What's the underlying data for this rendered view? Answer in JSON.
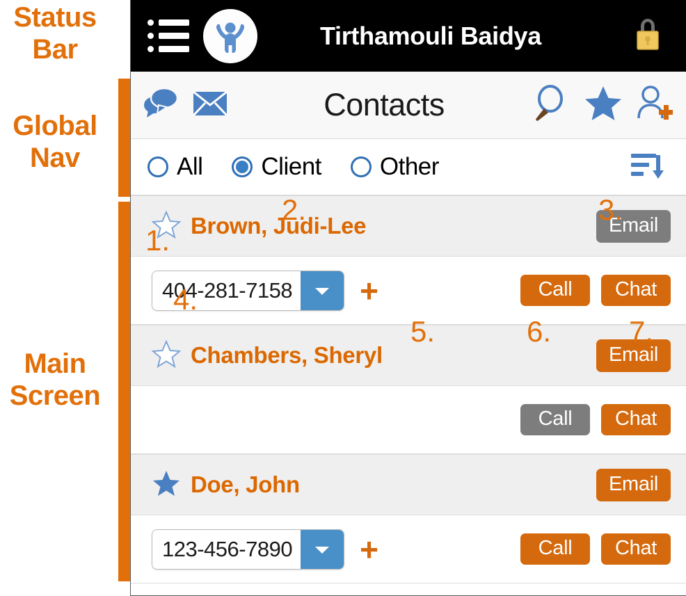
{
  "annotations": {
    "regions": [
      {
        "id": "status-bar",
        "label": "Status\nBar"
      },
      {
        "id": "global-nav",
        "label": "Global\nNav"
      },
      {
        "id": "main-screen",
        "label": "Main\nScreen"
      }
    ],
    "status_label_line1": "Status",
    "status_label_line2": "Bar",
    "global_label_line1": "Global",
    "global_label_line2": "Nav",
    "main_label_line1": "Main",
    "main_label_line2": "Screen",
    "numbers": [
      "1.",
      "2.",
      "3.",
      "4.",
      "5.",
      "6.",
      "7."
    ]
  },
  "status_bar": {
    "menu_icon": "hamburger-list-icon",
    "logo_icon": "app-logo-person-icon",
    "title": "Tirthamouli Baidya",
    "lock_icon": "padlock-icon"
  },
  "global_nav": {
    "chat_icon": "chat-bubbles-icon",
    "mail_icon": "envelope-icon",
    "title": "Contacts",
    "search_icon": "magnifier-icon",
    "favorites_icon": "star-icon",
    "add_contact_icon": "add-user-icon"
  },
  "filter": {
    "options": [
      {
        "label": "All",
        "selected": false
      },
      {
        "label": "Client",
        "selected": true
      },
      {
        "label": "Other",
        "selected": false
      }
    ],
    "sort_icon": "sort-descending-icon"
  },
  "contacts": [
    {
      "name": "Brown, Judi-Lee",
      "favorite": false,
      "star_icon": "star-outline-icon",
      "email_label": "Email",
      "email_state": "disabled",
      "phone_value": "404-281-7158",
      "has_phone": true,
      "add_phone_label": "+",
      "call_label": "Call",
      "call_state": "enabled",
      "chat_label": "Chat",
      "chat_state": "enabled"
    },
    {
      "name": "Chambers, Sheryl",
      "favorite": false,
      "star_icon": "star-outline-icon",
      "email_label": "Email",
      "email_state": "enabled",
      "phone_value": "",
      "has_phone": false,
      "add_phone_label": "",
      "call_label": "Call",
      "call_state": "disabled",
      "chat_label": "Chat",
      "chat_state": "enabled"
    },
    {
      "name": "Doe, John",
      "favorite": true,
      "star_icon": "star-filled-icon",
      "email_label": "Email",
      "email_state": "enabled",
      "phone_value": "123-456-7890",
      "has_phone": true,
      "add_phone_label": "+",
      "call_label": "Call",
      "call_state": "enabled",
      "chat_label": "Chat",
      "chat_state": "enabled"
    }
  ],
  "colors": {
    "accent_orange": "#D4690D",
    "annotation_orange": "#E2700A",
    "contact_name_orange": "#DB6800",
    "disabled_gray": "#7d7d7d",
    "icon_blue": "#4a7fc1",
    "select_arrow_blue": "#4a90c8",
    "status_bar_black": "#000000",
    "row_gray": "#efefef"
  }
}
